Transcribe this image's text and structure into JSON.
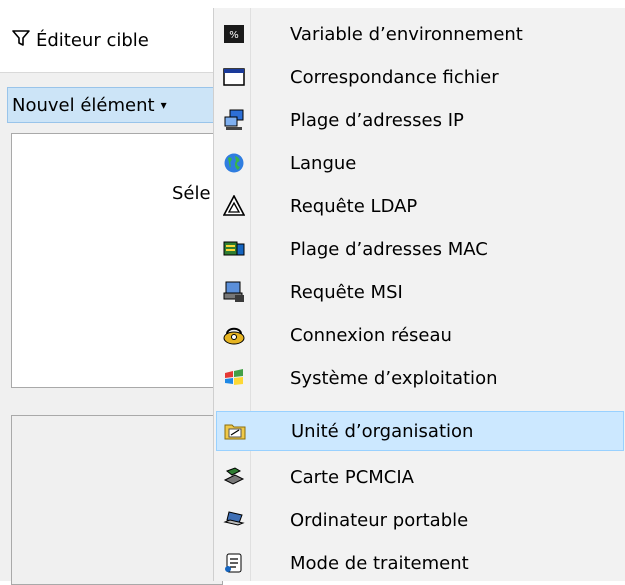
{
  "toolbar": {
    "target_editor_label": "Éditeur cible"
  },
  "left_panel": {
    "new_item_label": "Nouvel élément",
    "new_item_caret": "▾",
    "hint_text": "Séle"
  },
  "menu": {
    "items": [
      {
        "label": "Variable d’environnement",
        "icon": "env-variable-icon"
      },
      {
        "label": "Correspondance fichier",
        "icon": "file-match-icon"
      },
      {
        "label": "Plage d’adresses IP",
        "icon": "ip-range-icon"
      },
      {
        "label": "Langue",
        "icon": "globe-icon"
      },
      {
        "label": "Requête LDAP",
        "icon": "ldap-triangle-icon"
      },
      {
        "label": "Plage d’adresses MAC",
        "icon": "mac-range-icon"
      },
      {
        "label": "Requête MSI",
        "icon": "msi-query-icon"
      },
      {
        "label": "Connexion réseau",
        "icon": "network-connection-icon"
      },
      {
        "label": "Système d’exploitation",
        "icon": "windows-os-icon"
      },
      {
        "label": "Unité d’organisation",
        "icon": "org-unit-icon",
        "highlighted": true
      },
      {
        "label": "Carte PCMCIA",
        "icon": "pcmcia-card-icon"
      },
      {
        "label": "Ordinateur portable",
        "icon": "laptop-icon"
      },
      {
        "label": "Mode de traitement",
        "icon": "processing-mode-icon"
      }
    ]
  },
  "colors": {
    "menu_highlight": "#cce8ff",
    "button_highlight": "#cce4f7"
  }
}
